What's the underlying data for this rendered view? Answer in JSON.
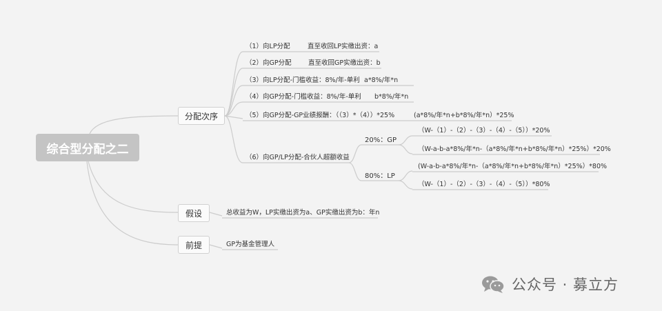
{
  "root": {
    "label": "综合型分配之二"
  },
  "branches": {
    "order": {
      "label": "分配次序"
    },
    "assume": {
      "label": "假设"
    },
    "premise": {
      "label": "前提"
    }
  },
  "order_items": [
    {
      "name": "（1）向LP分配",
      "detail": "直至收回LP实缴出资：a"
    },
    {
      "name": "（2）向GP分配",
      "detail": "直至收回GP实缴出资：b"
    },
    {
      "name": "（3）向LP分配-门槛收益：8%/年-单利",
      "detail": "a*8%/年*n"
    },
    {
      "name": "（4）向GP分配-门槛收益：8%/年-单利",
      "detail": "b*8%/年*n"
    },
    {
      "name": "（5）向GP分配-GP业绩报酬：（（3）*（4））*25%",
      "detail": "(a*8%/年*n+b*8%/年*n）*25%"
    },
    {
      "name": "（6）向GP/LP分配-合伙人超额收益",
      "detail": ""
    }
  ],
  "excess": {
    "gp": {
      "label": "20%：GP",
      "formulas": [
        "（W-（1）-（2）-（3）-（4）-（5））*20%",
        "（W-a-b-a*8%/年*n-（a*8%/年*n+b*8%/年*n）*25%）*20%"
      ]
    },
    "lp": {
      "label": "80%：LP",
      "formulas": [
        "(W-a-b-a*8%/年*n-（a*8%/年*n+b*8%/年*n）*25%）*80%",
        "（W-（1）-（2）-（3）-（4）-（5））*80%"
      ]
    }
  },
  "assumption": {
    "text": "总收益为W，LP实缴出资为a、GP实缴出资为b：年n"
  },
  "premise": {
    "text": "GP为基金管理人"
  },
  "watermark": {
    "text": "公众号 · 募立方",
    "icon": "wechat-icon"
  },
  "colors": {
    "line": "#c8c8c8",
    "root_bg": "#c4c4c4",
    "background": "#f3f3f3"
  }
}
